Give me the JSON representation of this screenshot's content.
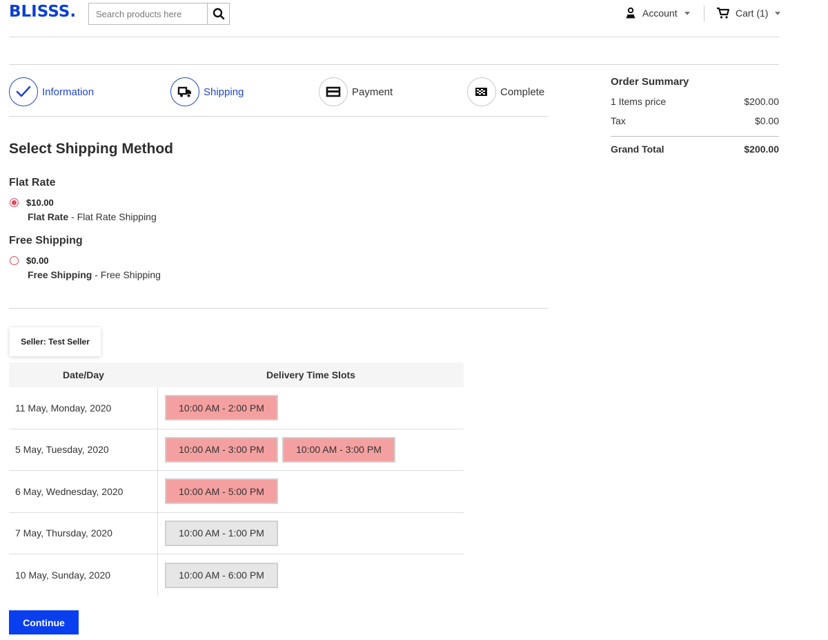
{
  "header": {
    "logo": "BLISSS.",
    "search_placeholder": "Search products here",
    "account_label": "Account",
    "cart_label": "Cart (1)"
  },
  "steps": [
    {
      "label": "Information",
      "icon": "check-icon",
      "state": "done"
    },
    {
      "label": "Shipping",
      "icon": "truck-icon",
      "state": "active"
    },
    {
      "label": "Payment",
      "icon": "card-icon",
      "state": "pending"
    },
    {
      "label": "Complete",
      "icon": "flag-icon",
      "state": "pending"
    }
  ],
  "summary": {
    "title": "Order Summary",
    "items_label": "1 Items price",
    "items_value": "$200.00",
    "tax_label": "Tax",
    "tax_value": "$0.00",
    "total_label": "Grand Total",
    "total_value": "$200.00"
  },
  "shipping": {
    "title": "Select Shipping Method",
    "methods": [
      {
        "group": "Flat Rate",
        "price": "$10.00",
        "name": "Flat Rate",
        "description": " - Flat Rate Shipping",
        "selected": true
      },
      {
        "group": "Free Shipping",
        "price": "$0.00",
        "name": "Free Shipping",
        "description": " - Free Shipping",
        "selected": false
      }
    ]
  },
  "seller": {
    "label": "Seller: Test Seller"
  },
  "slots_table": {
    "col_date": "Date/Day",
    "col_slots": "Delivery Time Slots",
    "rows": [
      {
        "date": "11 May, Monday, 2020",
        "slots": [
          {
            "text": "10:00 AM - 2:00 PM",
            "status": "booked"
          }
        ]
      },
      {
        "date": "5 May, Tuesday, 2020",
        "slots": [
          {
            "text": "10:00 AM - 3:00 PM",
            "status": "booked"
          },
          {
            "text": "10:00 AM - 3:00 PM",
            "status": "booked"
          }
        ]
      },
      {
        "date": "6 May, Wednesday, 2020",
        "slots": [
          {
            "text": "10:00 AM - 5:00 PM",
            "status": "booked"
          }
        ]
      },
      {
        "date": "7 May, Thursday, 2020",
        "slots": [
          {
            "text": "10:00 AM - 1:00 PM",
            "status": "available"
          }
        ]
      },
      {
        "date": "10 May, Sunday, 2020",
        "slots": [
          {
            "text": "10:00 AM - 6:00 PM",
            "status": "available"
          }
        ]
      }
    ]
  },
  "continue_label": "Continue",
  "colors": {
    "brand": "#0a3fd4",
    "accent": "#1f46c8",
    "booked_slot": "#f5a0a0",
    "available_slot": "#e6e6e6",
    "radio": "#e24a5c",
    "button": "#0a3ff0"
  }
}
